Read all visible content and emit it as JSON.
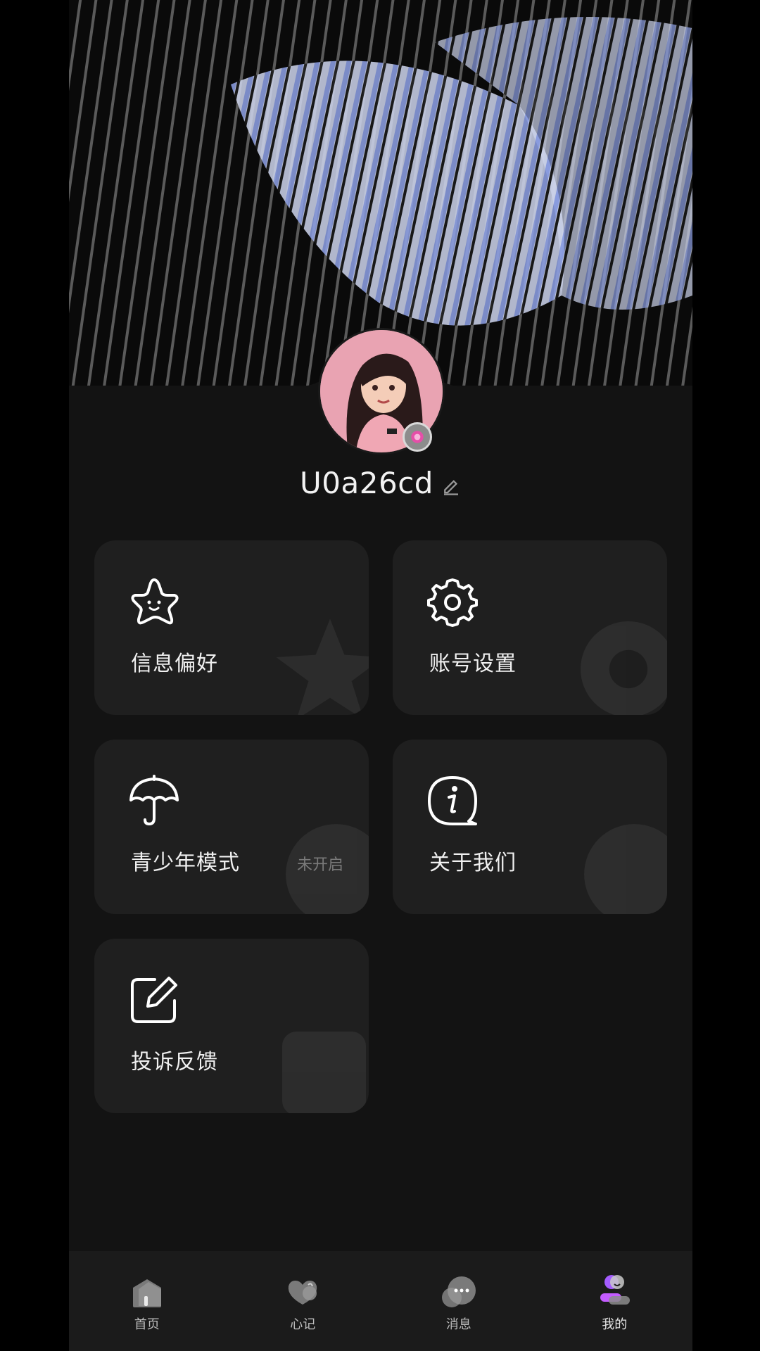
{
  "profile": {
    "username": "U0a26cd"
  },
  "menu": [
    {
      "id": "preferences",
      "label": "信息偏好",
      "icon": "star-face-icon"
    },
    {
      "id": "account-settings",
      "label": "账号设置",
      "icon": "gear-icon"
    },
    {
      "id": "youth-mode",
      "label": "青少年模式",
      "icon": "umbrella-icon",
      "status": "未开启"
    },
    {
      "id": "about-us",
      "label": "关于我们",
      "icon": "info-bubble-icon"
    },
    {
      "id": "feedback",
      "label": "投诉反馈",
      "icon": "edit-square-icon"
    }
  ],
  "nav": [
    {
      "label": "首页",
      "icon": "home-icon",
      "active": false
    },
    {
      "label": "心记",
      "icon": "heart-note-icon",
      "active": false
    },
    {
      "label": "消息",
      "icon": "message-icon",
      "active": false
    },
    {
      "label": "我的",
      "icon": "profile-icon",
      "active": true
    }
  ],
  "colors": {
    "background": "#131313",
    "card": "#1f1f1f",
    "accent": "#a45cff",
    "badge": "#e54fa8"
  }
}
